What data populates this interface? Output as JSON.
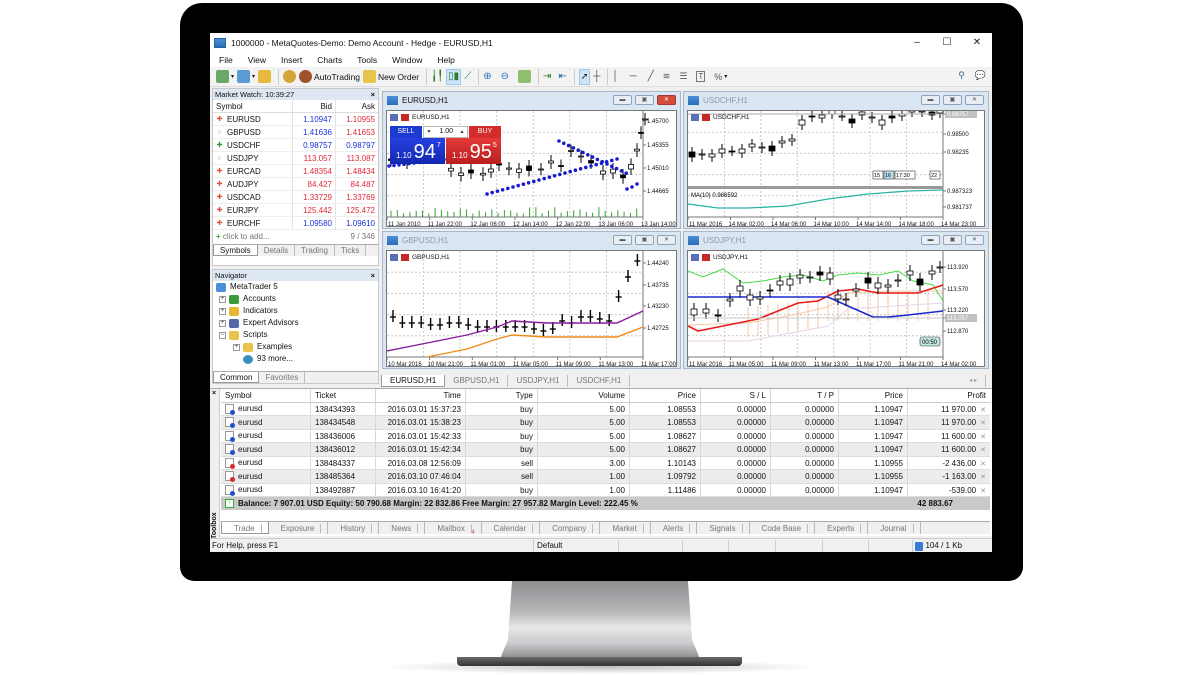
{
  "window": {
    "title": "1000000 - MetaQuotes-Demo: Demo Account - Hedge - EURUSD,H1",
    "controls": [
      "–",
      "☐",
      "✕"
    ]
  },
  "menu": [
    "File",
    "View",
    "Insert",
    "Charts",
    "Tools",
    "Window",
    "Help"
  ],
  "toolbar": {
    "autotrading_label": "AutoTrading",
    "new_order_label": "New Order"
  },
  "market_watch": {
    "title": "Market Watch: 10:39:27",
    "columns": [
      "Symbol",
      "Bid",
      "Ask"
    ],
    "rows": [
      {
        "symbol": "EURUSD",
        "bid": "1.10947",
        "ask": "1.10955",
        "dir": "down",
        "bid_color": "blue",
        "ask_color": "red"
      },
      {
        "symbol": "GBPUSD",
        "bid": "1.41636",
        "ask": "1.41653",
        "dir": "none",
        "bid_color": "blue",
        "ask_color": "red"
      },
      {
        "symbol": "USDCHF",
        "bid": "0.98757",
        "ask": "0.98797",
        "dir": "up",
        "bid_color": "blue",
        "ask_color": "blue"
      },
      {
        "symbol": "USDJPY",
        "bid": "113.057",
        "ask": "113.087",
        "dir": "none",
        "bid_color": "red",
        "ask_color": "red"
      },
      {
        "symbol": "EURCAD",
        "bid": "1.48354",
        "ask": "1.48434",
        "dir": "down",
        "bid_color": "red",
        "ask_color": "red"
      },
      {
        "symbol": "AUDJPY",
        "bid": "84.427",
        "ask": "84.487",
        "dir": "down",
        "bid_color": "red",
        "ask_color": "red"
      },
      {
        "symbol": "USDCAD",
        "bid": "1.33729",
        "ask": "1.33769",
        "dir": "down",
        "bid_color": "red",
        "ask_color": "red"
      },
      {
        "symbol": "EURJPY",
        "bid": "125.442",
        "ask": "125.472",
        "dir": "down",
        "bid_color": "red",
        "ask_color": "red"
      },
      {
        "symbol": "EURCHF",
        "bid": "1.09580",
        "ask": "1.09610",
        "dir": "down",
        "bid_color": "blue",
        "ask_color": "blue"
      }
    ],
    "add_label": "click to add...",
    "count": "9 / 346",
    "tabs": [
      "Symbols",
      "Details",
      "Trading",
      "Ticks"
    ]
  },
  "navigator": {
    "title": "Navigator",
    "root": "MetaTrader 5",
    "items": [
      {
        "label": "Accounts",
        "level": 1
      },
      {
        "label": "Indicators",
        "level": 1
      },
      {
        "label": "Expert Advisors",
        "level": 1
      },
      {
        "label": "Scripts",
        "level": 1
      },
      {
        "label": "Examples",
        "level": 2
      },
      {
        "label": "93 more...",
        "level": 2
      }
    ],
    "tabs": [
      "Common",
      "Favorites"
    ]
  },
  "charts": [
    {
      "id": "eurusd",
      "window_title": "EURUSD,H1",
      "label": "EURUSD,H1",
      "active": true,
      "price_ticks": [
        "1.45700",
        "1.45355",
        "1.45010",
        "1.44665"
      ],
      "time_ticks": [
        "11 Jan 2010",
        "11 Jan 22:00",
        "12 Jan 06:00",
        "12 Jan 14:00",
        "12 Jan 22:00",
        "13 Jan 06:00",
        "13 Jan 14:00"
      ],
      "one_click": {
        "sell_label": "SELL",
        "buy_label": "BUY",
        "volume": "1.00",
        "sell_prefix": "1.10",
        "sell_big": "94",
        "sell_pip": "7",
        "buy_prefix": "1.10",
        "buy_big": "95",
        "buy_pip": "5"
      }
    },
    {
      "id": "usdchf",
      "window_title": "USDCHF,H1",
      "label": "USDCHF,H1",
      "active": false,
      "price_ticks": [
        "0.98757",
        "0.98500",
        "0.98235"
      ],
      "indicator_label": "MA(10) 0.986592",
      "indicator_ticks": [
        "0.987323",
        "0.981737"
      ],
      "time_markers": [
        "15",
        "16",
        "17:30",
        "22"
      ],
      "time_ticks": [
        "11 Mar 2016",
        "14 Mar 02:00",
        "14 Mar 06:00",
        "14 Mar 10:00",
        "14 Mar 14:00",
        "14 Mar 18:00",
        "14 Mar 23:00"
      ]
    },
    {
      "id": "gbpusd",
      "window_title": "GBPUSD,H1",
      "label": "GBPUSD,H1",
      "active": false,
      "price_ticks": [
        "1.44240",
        "1.43735",
        "1.43230",
        "1.42725"
      ],
      "time_ticks": [
        "10 Mar 2016",
        "10 Mar 21:00",
        "11 Mar 01:00",
        "11 Mar 05:00",
        "11 Mar 09:00",
        "11 Mar 13:00",
        "11 Mar 17:00"
      ]
    },
    {
      "id": "usdjpy",
      "window_title": "USDJPY,H1",
      "label": "USDJPY,H1",
      "active": false,
      "price_ticks": [
        "113.920",
        "113.570",
        "113.220",
        "113.057",
        "112.870"
      ],
      "timer": "00:50",
      "time_ticks": [
        "11 Mar 2016",
        "11 Mar 05:00",
        "11 Mar 09:00",
        "11 Mar 13:00",
        "11 Mar 17:00",
        "11 Mar 21:00",
        "14 Mar 02:00"
      ]
    }
  ],
  "chart_tabs": [
    "EURUSD,H1",
    "GBPUSD,H1",
    "USDJPY,H1",
    "USDCHF,H1"
  ],
  "trade": {
    "columns": [
      "Symbol",
      "Ticket",
      "Time",
      "Type",
      "Volume",
      "Price",
      "S / L",
      "T / P",
      "Price",
      "Profit"
    ],
    "rows": [
      {
        "symbol": "eurusd",
        "ticket": "138434393",
        "time": "2016.03.01 15:37:23",
        "type": "buy",
        "volume": "5.00",
        "price": "1.08553",
        "sl": "0.00000",
        "tp": "0.00000",
        "cur": "1.10947",
        "profit": "11 970.00"
      },
      {
        "symbol": "eurusd",
        "ticket": "138434548",
        "time": "2016.03.01 15:38:23",
        "type": "buy",
        "volume": "5.00",
        "price": "1.08553",
        "sl": "0.00000",
        "tp": "0.00000",
        "cur": "1.10947",
        "profit": "11 970.00"
      },
      {
        "symbol": "eurusd",
        "ticket": "138436006",
        "time": "2016.03.01 15:42:33",
        "type": "buy",
        "volume": "5.00",
        "price": "1.08627",
        "sl": "0.00000",
        "tp": "0.00000",
        "cur": "1.10947",
        "profit": "11 600.00"
      },
      {
        "symbol": "eurusd",
        "ticket": "138436012",
        "time": "2016.03.01 15:42:34",
        "type": "buy",
        "volume": "5.00",
        "price": "1.08627",
        "sl": "0.00000",
        "tp": "0.00000",
        "cur": "1.10947",
        "profit": "11 600.00"
      },
      {
        "symbol": "eurusd",
        "ticket": "138484337",
        "time": "2016.03.08 12:56:09",
        "type": "sell",
        "volume": "3.00",
        "price": "1.10143",
        "sl": "0.00000",
        "tp": "0.00000",
        "cur": "1.10955",
        "profit": "-2 436.00"
      },
      {
        "symbol": "eurusd",
        "ticket": "138485364",
        "time": "2016.03.10 07:46:04",
        "type": "sell",
        "volume": "1.00",
        "price": "1.09792",
        "sl": "0.00000",
        "tp": "0.00000",
        "cur": "1.10955",
        "profit": "-1 163.00"
      },
      {
        "symbol": "eurusd",
        "ticket": "138492887",
        "time": "2016.03.10 16:41:20",
        "type": "buy",
        "volume": "1.00",
        "price": "1.11486",
        "sl": "0.00000",
        "tp": "0.00000",
        "cur": "1.10947",
        "profit": "-539.00"
      }
    ],
    "summary": "Balance: 7 907.01 USD  Equity: 50 790.68  Margin: 22 832.86  Free Margin: 27 957.82  Margin Level: 222.45 %",
    "total_profit": "42 883.67"
  },
  "toolbox": {
    "side_label": "Toolbox",
    "tabs": [
      "Trade",
      "Exposure",
      "History",
      "News",
      "Mailbox",
      "Calendar",
      "Company",
      "Market",
      "Alerts",
      "Signals",
      "Code Base",
      "Experts",
      "Journal"
    ],
    "mailbox_badge": "4"
  },
  "statusbar": {
    "help": "For Help, press F1",
    "profile": "Default",
    "traffic": "104 / 1 Kb"
  }
}
